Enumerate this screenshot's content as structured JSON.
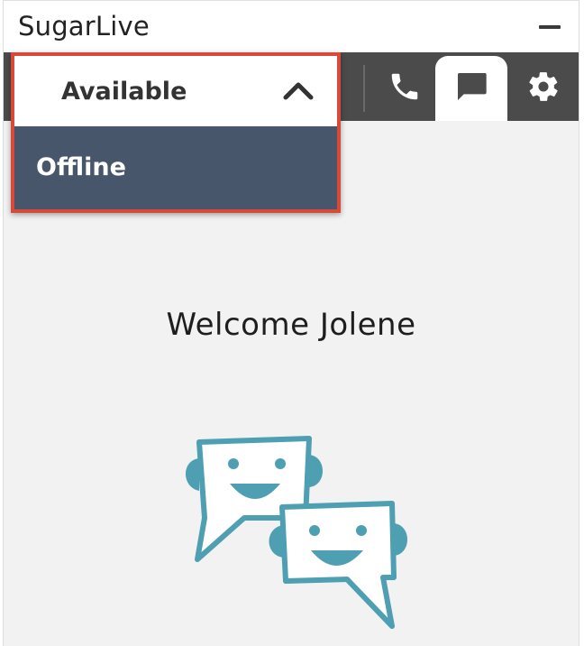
{
  "window": {
    "title": "SugarLive"
  },
  "status_menu": {
    "current": "Available",
    "options": [
      "Offline"
    ]
  },
  "toolbar": {
    "icons": [
      "phone-icon",
      "chat-icon",
      "gear-icon"
    ],
    "active": "chat-icon"
  },
  "main": {
    "welcome": "Welcome Jolene"
  },
  "colors": {
    "toolbar_bg": "#4b4b4b",
    "highlight_border": "#d9493a",
    "dropdown_option_bg": "#48566b",
    "illustration": "#4e9fb2",
    "panel_bg": "#f2f2f2"
  }
}
